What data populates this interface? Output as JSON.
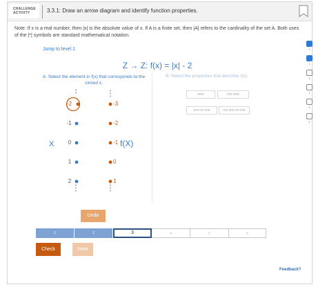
{
  "header": {
    "badge_line1": "CHALLENGE",
    "badge_line2": "ACTIVITY",
    "title": "3.3.1: Draw an arrow diagram and identify function properties."
  },
  "note": "Note: If x is a real number, then |x| is the absolute value of x. If A is a finite set, then |A| refers to the cardinality of the set A. Both uses of the |*| symbols are standard mathematical notation.",
  "jump_link": "Jump to level 1",
  "function_title": "Z → Z: f(x) = |x| - 2",
  "instructions": {
    "a": "A. Select the element in f(x) that corresponds to the circled x.",
    "b": "B. Select the properties that describe f(x)."
  },
  "properties": [
    "onto",
    "not onto",
    "one-to-one",
    "not one-to-one"
  ],
  "diagram": {
    "domain_label": "X",
    "codomain_label": "f(X)",
    "domain": [
      "-2",
      "-1",
      "0",
      "1",
      "2"
    ],
    "codomain": [
      "-3",
      "-2",
      "-1",
      "0",
      "1"
    ],
    "circled_domain_index": 0,
    "selected_codomain_index": 2,
    "colors": {
      "blue": "#3a79c4",
      "orange": "#c45a10"
    }
  },
  "buttons": {
    "undo": "Undo",
    "check": "Check",
    "next": "Next"
  },
  "levels": {
    "labels": [
      "1",
      "2",
      "3",
      "4",
      "5",
      "6"
    ],
    "current": 3,
    "completed": 2
  },
  "feedback": "Feedback?",
  "side_progress": {
    "items": [
      "1",
      "2",
      "3",
      "4",
      "5",
      "6"
    ],
    "completed": 2
  },
  "icons": {
    "bookmark": "bookmark-icon",
    "check": "check-icon"
  }
}
